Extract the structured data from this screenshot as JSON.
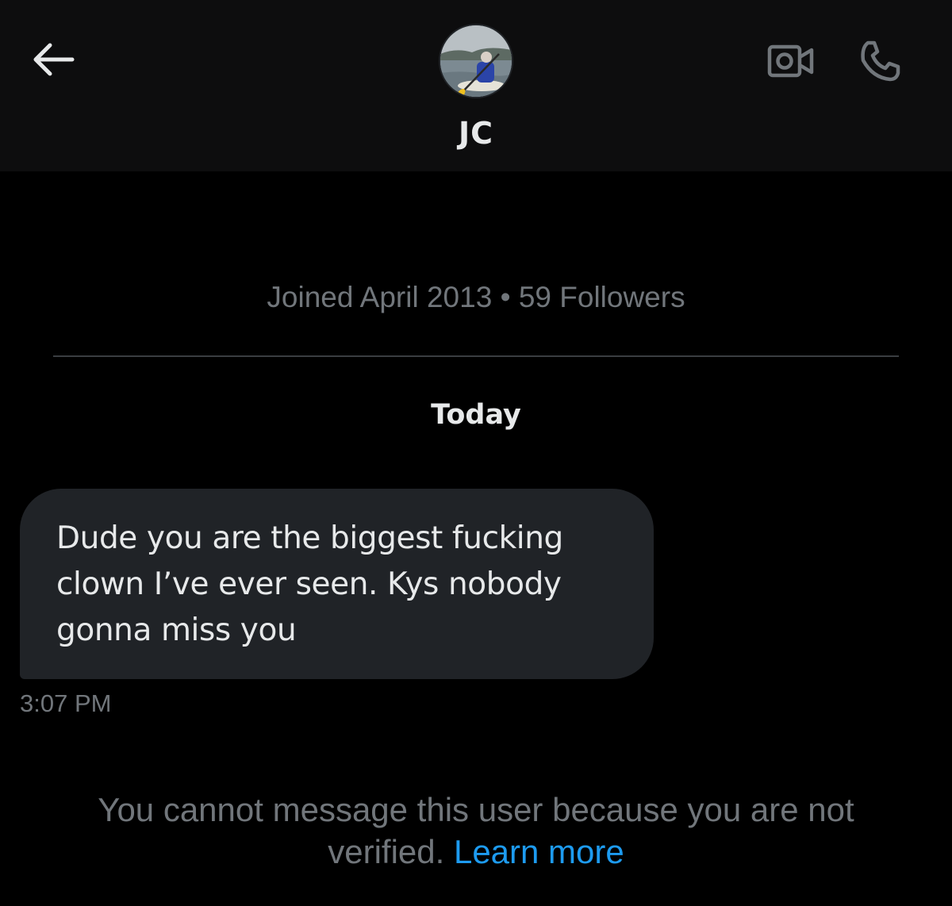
{
  "header": {
    "contact_name": "JC",
    "icons": {
      "back": "arrow-left-icon",
      "video": "video-camera-icon",
      "call": "phone-icon"
    }
  },
  "profile": {
    "joined": "Joined April 2013",
    "separator": "•",
    "followers": "59 Followers"
  },
  "conversation": {
    "day_label": "Today",
    "messages": [
      {
        "text": "Dude you are the biggest fucking clown I’ve ever seen. Kys nobody gonna miss you",
        "time": "3:07 PM"
      }
    ]
  },
  "notice": {
    "text": "You cannot message this user because you are not verified.",
    "link_label": "Learn more",
    "link_color": "#1d9bf0"
  },
  "colors": {
    "background": "#000000",
    "header_background": "#0d0d0e",
    "bubble": "#202327",
    "secondary_text": "#71767b",
    "primary_text": "#e7e9ea"
  }
}
